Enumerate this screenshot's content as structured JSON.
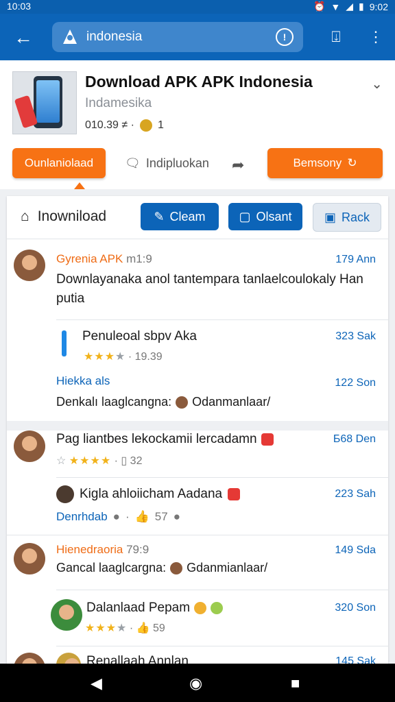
{
  "status": {
    "time": "10:03",
    "right_time": "9:02"
  },
  "search": {
    "query": "indonesia"
  },
  "app": {
    "title": "Download APK APK Indonesia",
    "subtitle": "Indamesika",
    "meta_left": "010.39 ≠ ·",
    "meta_right": "1"
  },
  "actions": {
    "left_btn": "Ounlaniolaad",
    "middle": "Indipluokan",
    "right_btn": "Bemsony"
  },
  "tabs": {
    "label": "Inowniload",
    "btn1": "Cleam",
    "btn2": "Olsant",
    "btn3": "Rack"
  },
  "feed": [
    {
      "name": "Gyrenia APK",
      "handle": "m1:9",
      "time": "179 Ann",
      "text": "Downlayanaka anol tantempara tanlaelcoulokaly Han putia"
    },
    {
      "title": "Penuleoal sbpv Aka",
      "rating_text": "· 19.39",
      "time": "323 Sak"
    },
    {
      "name": "Hiekka als",
      "time": "122 Son",
      "text": "Denkalı laaglcangna:",
      "suffix": "Odanmanlaar/"
    },
    {
      "text": "Pag liantbes lekockamii lercadamn",
      "rating_count": "32",
      "time": "Б68 Den"
    },
    {
      "text": "Kigla ahloiicham Aadana",
      "link": "Denrhdab",
      "likes": "57",
      "time": "223 Sah"
    },
    {
      "name": "Hienedraoria",
      "handle": "79:9",
      "time": "149 Sda",
      "text": "Gancal laaglcargna:",
      "suffix": "Gdanmianlaar/"
    },
    {
      "title": "Dalanlaad Pepam",
      "likes": "59",
      "time": "320 Son"
    },
    {
      "title": "Renallaah Annlan",
      "time": "145 Sak"
    }
  ]
}
